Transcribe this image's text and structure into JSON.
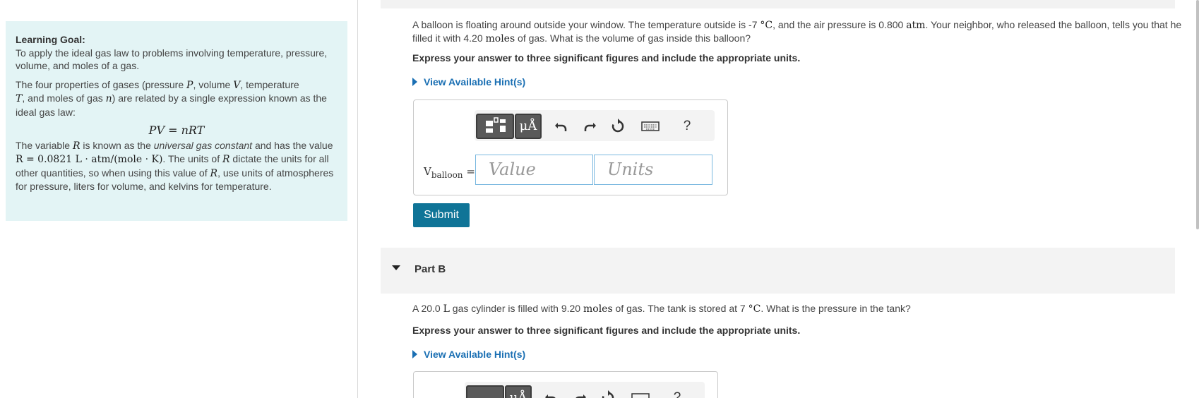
{
  "learning_goal": {
    "title": "Learning Goal:",
    "intro": "To apply the ideal gas law to problems involving temperature, pressure, volume, and moles of a gas.",
    "p2_a": "The four properties of gases (pressure ",
    "p2_P": "P",
    "p2_b": ", volume ",
    "p2_V": "V",
    "p2_c": ", temperature ",
    "p2_T": "T",
    "p2_d": ", and moles of gas ",
    "p2_n": "n",
    "p2_e": ") are related by a single expression known as the ideal gas law:",
    "equation": "PV = nRT",
    "p3_a": "The variable ",
    "p3_R1": "R",
    "p3_b": " is known as the ",
    "p3_em": "universal gas constant",
    "p3_c": " and has the value ",
    "p3_value": "R = 0.0821 L · atm/(mole · K)",
    "p3_d": ". The units of ",
    "p3_R2": "R",
    "p3_e": " dictate the units for all other quantities, so when using this value of ",
    "p3_R3": "R",
    "p3_f": ", use units of atmospheres for pressure, liters for volume, and kelvins for temperature."
  },
  "part_a": {
    "q_1": "A balloon is floating around outside your window. The temperature outside is -7 ",
    "q_unit1": "°C",
    "q_2": ", and the air pressure is 0.800 ",
    "q_unit2": "atm",
    "q_3": ". Your neighbor, who released the balloon, tells you that he filled it with 4.20 ",
    "q_unit3": "moles",
    "q_4": " of gas. What is the volume of gas inside this balloon?",
    "instruction": "Express your answer to three significant figures and include the appropriate units.",
    "hint": "View Available Hint(s)",
    "var_main": "V",
    "var_sub": "balloon",
    "var_eq": " =",
    "value_placeholder": "Value",
    "units_placeholder": "Units",
    "toolbar_mu": "μÅ",
    "toolbar_help": "?",
    "submit": "Submit"
  },
  "part_b": {
    "title": "Part B",
    "q_1": "A 20.0 ",
    "q_unit1": "L",
    "q_2": " gas cylinder is filled with 9.20 ",
    "q_unit2": "moles",
    "q_3": " of gas. The tank is stored at 7 ",
    "q_unit3": "°C",
    "q_4": ". What is the pressure in the tank?",
    "instruction": "Express your answer to three significant figures and include the appropriate units.",
    "hint": "View Available Hint(s)",
    "toolbar_mu": "μÅ",
    "toolbar_help": "?"
  },
  "colors": {
    "goal_bg": "#e3f4f5",
    "hint_link": "#1a6fb3",
    "submit_bg": "#0f7497",
    "input_border": "#7ab8e0"
  },
  "icons": [
    "templates-icon",
    "units-symbol-icon",
    "undo-icon",
    "redo-icon",
    "reset-icon",
    "keyboard-icon",
    "help-icon",
    "hint-expand-icon",
    "collapse-caret-icon"
  ]
}
